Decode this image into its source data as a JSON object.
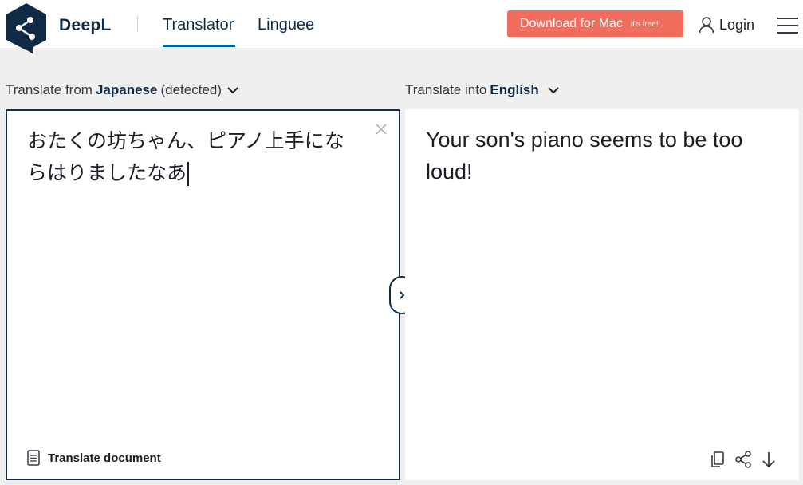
{
  "header": {
    "brand": "DeepL",
    "tabs": [
      "Translator",
      "Linguee"
    ],
    "active_tab": "Translator",
    "download_label": "Download for Mac",
    "download_badge": "it's free!",
    "login_label": "Login"
  },
  "source": {
    "prefix": "Translate from",
    "language": "Japanese",
    "suffix": "(detected)",
    "text": "おたくの坊ちゃん、ピアノ上手にならはりましたなあ",
    "translate_document_label": "Translate document"
  },
  "target": {
    "prefix": "Translate into",
    "language": "English",
    "text": "Your son's piano seems to be too loud!"
  },
  "colors": {
    "brand_navy": "#0f2b46",
    "accent_blue": "#006494",
    "download_button": "#f16e5e",
    "background": "#efefef"
  },
  "icons": [
    "deepl-logo-icon",
    "user-icon",
    "menu-icon",
    "chevron-down-icon",
    "close-icon",
    "document-icon",
    "chevron-right-icon",
    "copy-icon",
    "share-icon",
    "download-arrow-icon"
  ]
}
